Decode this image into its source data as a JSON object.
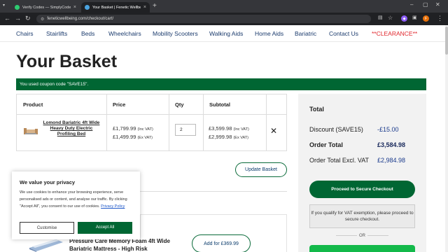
{
  "browser": {
    "tabs": [
      {
        "title": "Verify Codes — SimplyCodes",
        "active": false,
        "favicon_color": "#2ecc71"
      },
      {
        "title": "Your Basket | Fenetic Wellbeing",
        "active": true,
        "favicon_color": "#4aa3df"
      }
    ],
    "url": "feneticwellbeing.com/checkout/cart/",
    "profile_initial": "F"
  },
  "site_nav": {
    "items": [
      "Chairs",
      "Stairlifts",
      "Beds",
      "Wheelchairs",
      "Mobility Scooters",
      "Walking Aids",
      "Home Aids",
      "Bariatric",
      "Contact Us",
      "**CLEARANCE**"
    ]
  },
  "page": {
    "title": "Your Basket",
    "coupon_message": "You used coupon code \"SAVE15\"."
  },
  "basket": {
    "headers": {
      "product": "Product",
      "price": "Price",
      "qty": "Qty",
      "subtotal": "Subtotal"
    },
    "item": {
      "name": "Lomond Bariatric 4ft Wide Heavy Duty Electric Profiling Bed",
      "price_inc": "£1,799.99",
      "price_inc_tag": "(Inc VAT)",
      "price_ex": "£1,499.99",
      "price_ex_tag": "(Ex VAT)",
      "qty": "2",
      "subtotal_inc": "£3,599.98",
      "subtotal_inc_tag": "(Inc VAT)",
      "subtotal_ex": "£2,999.98",
      "subtotal_ex_tag": "(Ex VAT)"
    },
    "update_label": "Update Basket"
  },
  "upsell": {
    "title": "Pressure Care Memory Foam 4ft Wide Bariatric Mattress - High Risk",
    "add_label": "Add for £369.99"
  },
  "totals": {
    "heading": "Total",
    "discount_label": "Discount (SAVE15)",
    "discount_value": "-£15.00",
    "order_total_label": "Order Total",
    "order_total_value": "£3,584.98",
    "excl_vat_label": "Order Total Excl. VAT",
    "excl_vat_value": "£2,984.98",
    "checkout_label": "Proceed to Secure Checkout",
    "vat_note": "If you qualify for VAT exemption, please proceed to secure checkout.",
    "or_label": "OR"
  },
  "cookie": {
    "title": "We value your privacy",
    "body": "We use cookies to enhance your browsing experience, serve personalised ads or content, and analyse our traffic. By clicking \"Accept All\", you consent to our use of cookies.",
    "policy_link": "Privacy Policy",
    "customise_label": "Customise",
    "accept_label": "Accept All"
  },
  "colors": {
    "brand_green": "#006633",
    "link_navy": "#1a3a6c",
    "clearance_red": "#e0262c"
  }
}
